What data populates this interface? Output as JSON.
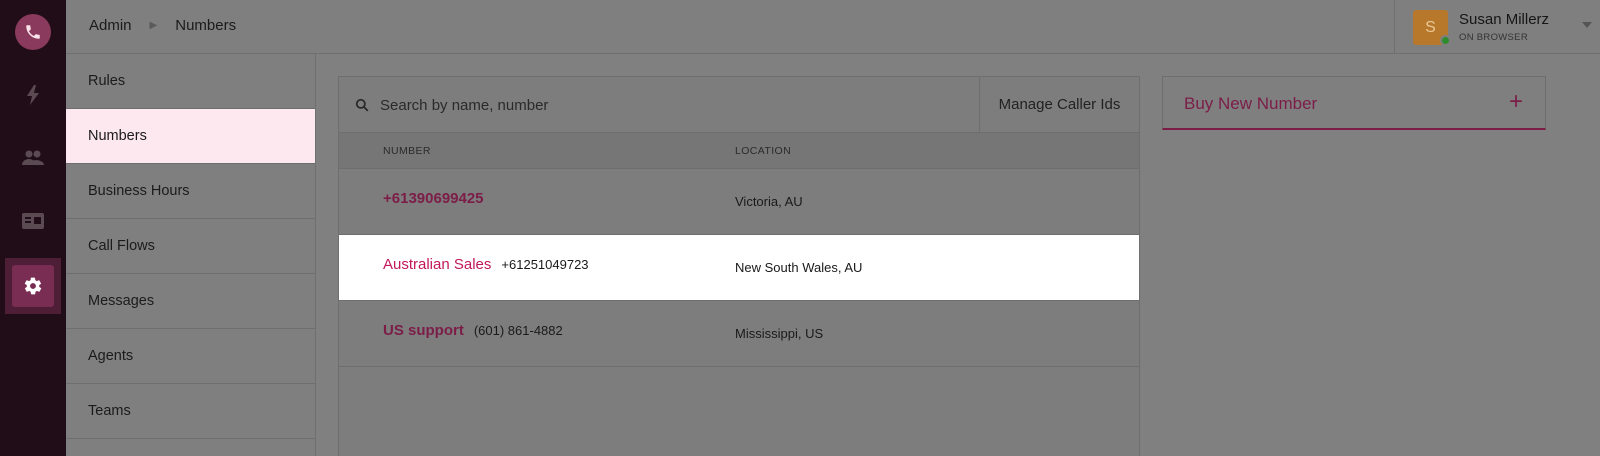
{
  "breadcrumb": {
    "parent": "Admin",
    "current": "Numbers"
  },
  "user": {
    "initial": "S",
    "name": "Susan Millerz",
    "status": "ON BROWSER"
  },
  "subnav": {
    "items": [
      {
        "label": "Rules"
      },
      {
        "label": "Numbers",
        "active": true
      },
      {
        "label": "Business Hours"
      },
      {
        "label": "Call Flows"
      },
      {
        "label": "Messages"
      },
      {
        "label": "Agents"
      },
      {
        "label": "Teams"
      }
    ]
  },
  "search": {
    "placeholder": "Search by name, number",
    "manage_label": "Manage Caller Ids"
  },
  "table": {
    "headers": {
      "number": "NUMBER",
      "location": "LOCATION"
    },
    "rows": [
      {
        "name": "+61390699425",
        "number": "",
        "location": "Victoria, AU"
      },
      {
        "name": "Australian Sales",
        "number": "+61251049723",
        "location": "New South Wales, AU",
        "selected": true
      },
      {
        "name": "US support",
        "number": "(601) 861-4882",
        "location": "Mississippi, US"
      }
    ]
  },
  "buy": {
    "label": "Buy New Number",
    "plus": "+"
  },
  "colors": {
    "accent": "#c2185b",
    "accent_dark": "#7c1d48",
    "rail": "#210d17",
    "active_nav": "#fde8ef"
  }
}
